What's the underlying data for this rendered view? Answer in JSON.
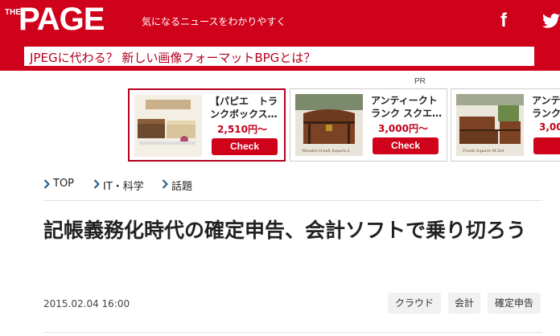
{
  "header": {
    "logo_the": "THE",
    "logo_page": "PAGE",
    "tagline": "気になるニュースをわかりやすく",
    "social": [
      {
        "icon": "facebook-icon",
        "glyph": "f"
      },
      {
        "icon": "twitter-icon"
      }
    ],
    "ticker_text": "JPEGに代わる？ 新しい画像フォーマットBPGとは？",
    "brand_color": "#d0021b"
  },
  "ads": {
    "label": "PR",
    "items": [
      {
        "title_line1": "【パピエ　トラ",
        "title_line2": "ンクボックス…",
        "price": "2,510円〜",
        "cta": "Check",
        "image_caption": "",
        "selected": true
      },
      {
        "title_line1": "アンティークト",
        "title_line2": "ランク スクエ…",
        "price": "3,000円〜",
        "cta": "Check",
        "image_caption": "Wooden trunk Square.L",
        "selected": false
      },
      {
        "title_line1": "アンテ",
        "title_line2": "ランク",
        "price": "3,00",
        "cta": "Ch",
        "image_caption": "Trunk Square M.Set",
        "selected": false
      }
    ]
  },
  "breadcrumb": [
    {
      "label": "TOP"
    },
    {
      "label": "IT・科学"
    },
    {
      "label": "話題"
    }
  ],
  "article": {
    "title": "記帳義務化時代の確定申告、会計ソフトで乗り切ろう",
    "date": "2015.02.04 16:00",
    "tags": [
      "クラウド",
      "会計",
      "確定申告"
    ]
  }
}
